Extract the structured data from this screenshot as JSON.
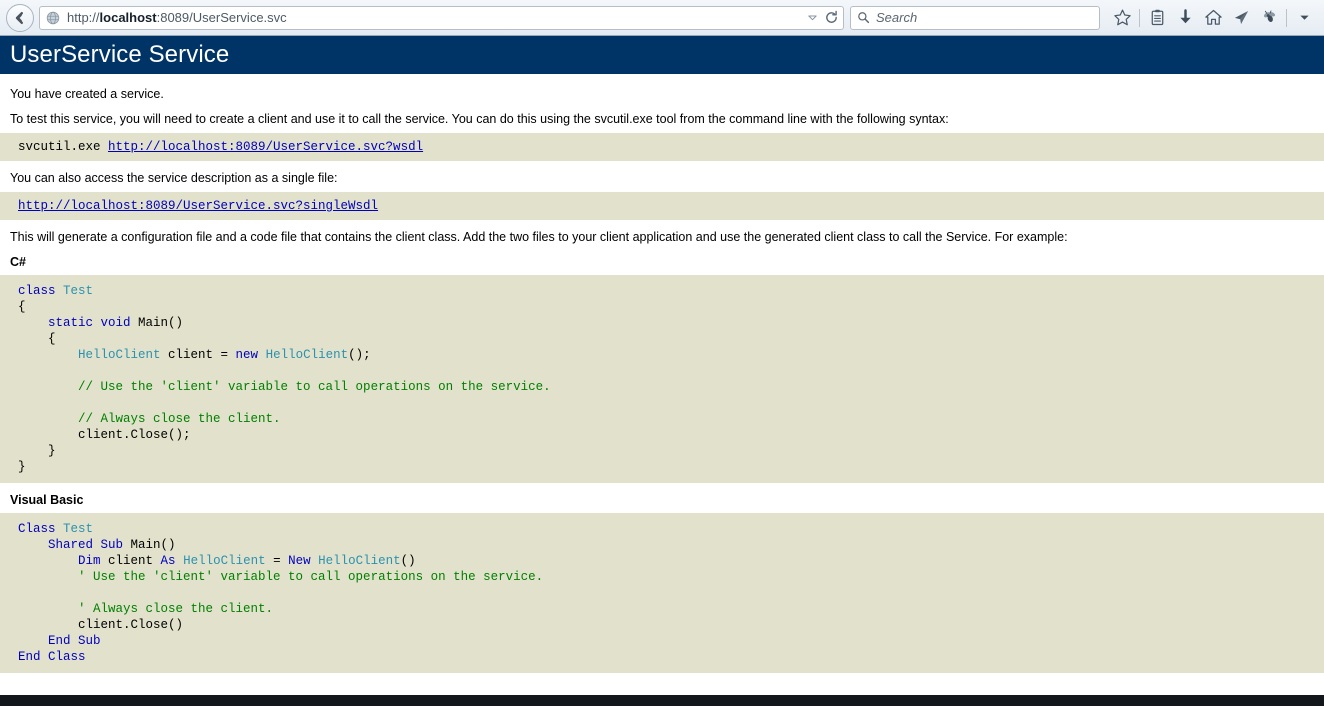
{
  "browser": {
    "back_button": "Back",
    "url_scheme": "http://",
    "url_host": "localhost",
    "url_rest": ":8089/UserService.svc",
    "url_full": "http://localhost:8089/UserService.svc",
    "url_dropdown": "history-dropdown",
    "reload": "Reload",
    "search_placeholder": "Search",
    "search_value": "",
    "toolbar_icons": [
      {
        "name": "bookmark-star-icon",
        "label": "Bookmark this page"
      },
      {
        "name": "library-icon",
        "label": "Show your library"
      },
      {
        "name": "download-icon",
        "label": "Downloads"
      },
      {
        "name": "home-icon",
        "label": "Home"
      },
      {
        "name": "paper-plane-icon",
        "label": "Send"
      },
      {
        "name": "bug-icon",
        "label": "Debugger"
      },
      {
        "name": "chevron-down-icon",
        "label": "More tools"
      }
    ]
  },
  "page": {
    "title": "UserService Service",
    "intro": "You have created a service.",
    "test_instructions": "To test this service, you will need to create a client and use it to call the service. You can do this using the svcutil.exe tool from the command line with the following syntax:",
    "svcutil_cmd_prefix": "svcutil.exe ",
    "wsdl_link": "http://localhost:8089/UserService.svc?wsdl",
    "single_file_note": "You can also access the service description as a single file:",
    "single_wsdl_link": "http://localhost:8089/UserService.svc?singleWsdl",
    "generate_note": "This will generate a configuration file and a code file that contains the client class. Add the two files to your client application and use the generated client class to call the Service. For example:",
    "csharp_label": "C#",
    "vb_label": "Visual Basic",
    "csharp_code": [
      [
        {
          "t": "class ",
          "c": "k"
        },
        {
          "t": "Test",
          "c": "t"
        }
      ],
      [
        {
          "t": "{",
          "c": ""
        }
      ],
      [
        {
          "t": "    ",
          "c": ""
        },
        {
          "t": "static void ",
          "c": "k"
        },
        {
          "t": "Main()",
          "c": ""
        }
      ],
      [
        {
          "t": "    {",
          "c": ""
        }
      ],
      [
        {
          "t": "        ",
          "c": ""
        },
        {
          "t": "HelloClient",
          "c": "t"
        },
        {
          "t": " client = ",
          "c": ""
        },
        {
          "t": "new ",
          "c": "k"
        },
        {
          "t": "HelloClient",
          "c": "t"
        },
        {
          "t": "();",
          "c": ""
        }
      ],
      [
        {
          "t": "",
          "c": ""
        }
      ],
      [
        {
          "t": "        ",
          "c": ""
        },
        {
          "t": "// Use the 'client' variable to call operations on the service.",
          "c": "cm"
        }
      ],
      [
        {
          "t": "",
          "c": ""
        }
      ],
      [
        {
          "t": "        ",
          "c": ""
        },
        {
          "t": "// Always close the client.",
          "c": "cm"
        }
      ],
      [
        {
          "t": "        client.Close();",
          "c": ""
        }
      ],
      [
        {
          "t": "    }",
          "c": ""
        }
      ],
      [
        {
          "t": "}",
          "c": ""
        }
      ]
    ],
    "vb_code": [
      [
        {
          "t": "Class ",
          "c": "k"
        },
        {
          "t": "Test",
          "c": "t"
        }
      ],
      [
        {
          "t": "    ",
          "c": ""
        },
        {
          "t": "Shared Sub ",
          "c": "k"
        },
        {
          "t": "Main()",
          "c": ""
        }
      ],
      [
        {
          "t": "        ",
          "c": ""
        },
        {
          "t": "Dim ",
          "c": "k"
        },
        {
          "t": "client ",
          "c": ""
        },
        {
          "t": "As ",
          "c": "k"
        },
        {
          "t": "HelloClient",
          "c": "t"
        },
        {
          "t": " = ",
          "c": ""
        },
        {
          "t": "New ",
          "c": "k"
        },
        {
          "t": "HelloClient",
          "c": "t"
        },
        {
          "t": "()",
          "c": ""
        }
      ],
      [
        {
          "t": "        ",
          "c": ""
        },
        {
          "t": "' Use the 'client' variable to call operations on the service.",
          "c": "cm"
        }
      ],
      [
        {
          "t": "",
          "c": ""
        }
      ],
      [
        {
          "t": "        ",
          "c": ""
        },
        {
          "t": "' Always close the client.",
          "c": "cm"
        }
      ],
      [
        {
          "t": "        client.Close()",
          "c": ""
        }
      ],
      [
        {
          "t": "    ",
          "c": ""
        },
        {
          "t": "End Sub",
          "c": "k"
        }
      ],
      [
        {
          "t": "",
          "c": ""
        },
        {
          "t": "End Class",
          "c": "k"
        }
      ]
    ]
  },
  "colors": {
    "header_bg": "#003366",
    "code_bg": "#E2E2CC",
    "keyword": "#0000C0",
    "type": "#2B91AF",
    "comment": "#008000",
    "link": "#0000C0"
  }
}
